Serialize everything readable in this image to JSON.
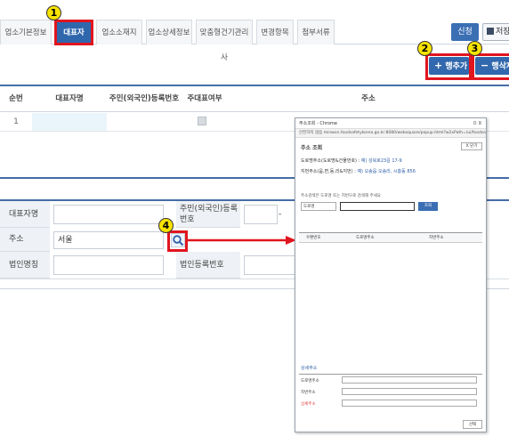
{
  "tabs": [
    "업소기본정보",
    "대표자",
    "업소소재지",
    "업소상세정보",
    "맞춤형건기관리사",
    "변경항목",
    "첨부서류"
  ],
  "buttons": {
    "apply": "신청",
    "save": "저장",
    "add_row": "행추가",
    "delete_row": "행삭제"
  },
  "icons": {
    "add": "plus-icon",
    "delete": "minus-icon",
    "save": "floppy-icon",
    "search": "magnifier-icon"
  },
  "callouts": [
    "1",
    "2",
    "3",
    "4"
  ],
  "grid": {
    "headers": [
      "순번",
      "대표자명",
      "주민(외국인)등록번호",
      "주대표여부",
      "주소"
    ],
    "rows": [
      {
        "no": "1",
        "name": "",
        "rrn": "",
        "main": "",
        "addr": ""
      }
    ]
  },
  "form": {
    "name_label": "대표자명",
    "rrn_label": "주민(외국인)등록번호",
    "rrn_sep": "-",
    "addr_label": "주소",
    "addr_value": "서울",
    "corp_label": "법인명칭",
    "corp_reg_label": "법인등록번호"
  },
  "popup": {
    "window_title": "주소조회 - Chrome",
    "window_controls": "ㅁ  X",
    "url": "안전하지 않음  minwon.foodsafetykorea.go.kr:8080/websquare/popup.html?w2xPath=/ui/foodsafety/jiyjk/popup/...",
    "heading": "주소 조회",
    "close_label": "X 닫기",
    "road_label": "도로명주소(도로명&건물번호) :",
    "road_example": "예) 성북로23길 17-9",
    "jibun_label": "지번주소(읍,면,동,리&지번) :",
    "jibun_example": "예) 오송읍 오송리, 시흥동 856",
    "search_hint": "주소검색은 도로명 또는 지번으로 검색해 주세요",
    "select_value": "도로명",
    "search_button": "조회",
    "col_zip": "우편번호",
    "col_road": "도로명주소",
    "col_jibun": "지번주소",
    "detail_heading": "상세주소",
    "detail_road": "도로명주소",
    "detail_jibun": "지번주소",
    "detail_extra": "상세주소",
    "select_button": "선택"
  },
  "colors": {
    "tab_active": "#2f67ad",
    "callout_box": "#e0151e",
    "callout_badge": "#f7e300"
  }
}
